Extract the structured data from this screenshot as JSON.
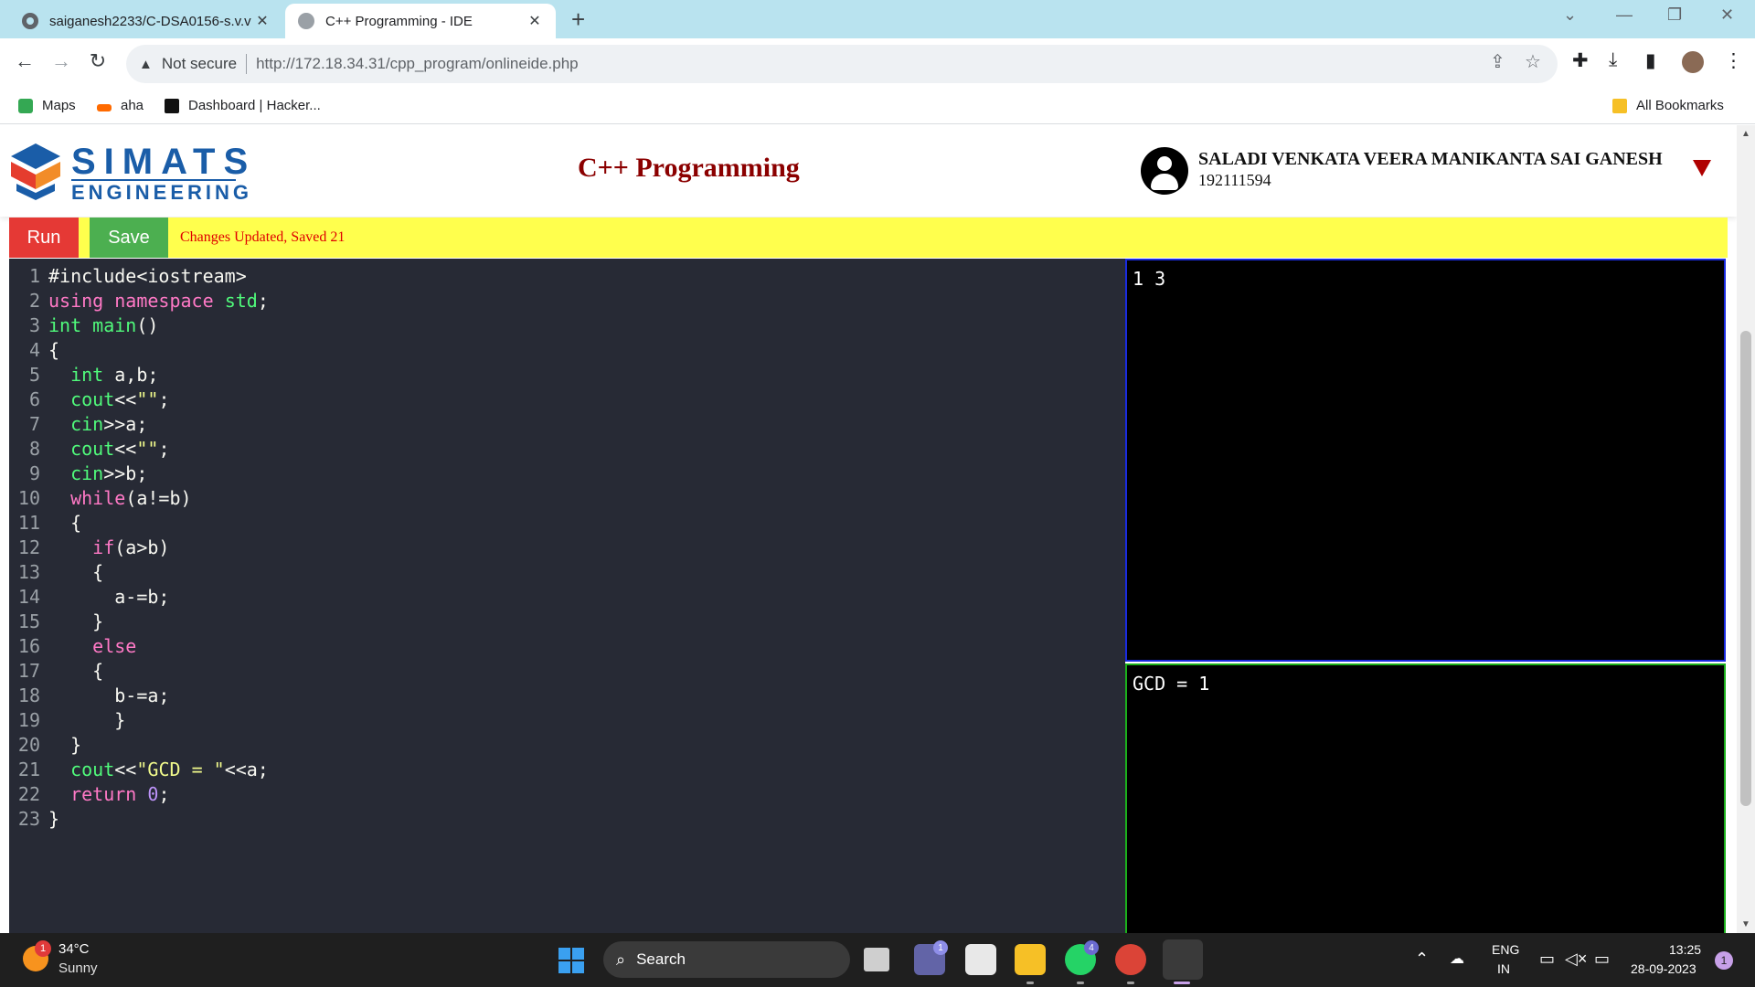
{
  "browser": {
    "tabs": [
      {
        "title": "saiganesh2233/C-DSA0156-s.v.v",
        "active": false
      },
      {
        "title": "C++ Programming - IDE",
        "active": true
      }
    ],
    "omnibox": {
      "security_label": "Not secure",
      "url": "http://172.18.34.31/cpp_program/onlineide.php"
    },
    "bookmarks": [
      {
        "label": "Maps"
      },
      {
        "label": "aha"
      },
      {
        "label": "Dashboard | Hacker..."
      }
    ],
    "all_bookmarks_label": "All Bookmarks"
  },
  "header": {
    "logo_line1": "SIMATS",
    "logo_line2": "ENGINEERING",
    "page_title": "C++ Programming",
    "user_name": "SALADI VENKATA VEERA MANIKANTA SAI GANESH",
    "user_id": "192111594"
  },
  "actions": {
    "run_label": "Run",
    "save_label": "Save",
    "status_message": "Changes Updated, Saved 21"
  },
  "editor": {
    "lines": [
      {
        "n": "1",
        "code": "#include<iostream>"
      },
      {
        "n": "2",
        "code": "using namespace std;"
      },
      {
        "n": "3",
        "code": "int main()"
      },
      {
        "n": "4",
        "code": "{"
      },
      {
        "n": "5",
        "code": "  int a,b;"
      },
      {
        "n": "6",
        "code": "  cout<<\"\";"
      },
      {
        "n": "7",
        "code": "  cin>>a;"
      },
      {
        "n": "8",
        "code": "  cout<<\"\";"
      },
      {
        "n": "9",
        "code": "  cin>>b;"
      },
      {
        "n": "10",
        "code": "  while(a!=b)"
      },
      {
        "n": "11",
        "code": "  {"
      },
      {
        "n": "12",
        "code": "    if(a>b)"
      },
      {
        "n": "13",
        "code": "    {"
      },
      {
        "n": "14",
        "code": "      a-=b;"
      },
      {
        "n": "15",
        "code": "    }"
      },
      {
        "n": "16",
        "code": "    else"
      },
      {
        "n": "17",
        "code": "    {"
      },
      {
        "n": "18",
        "code": "      b-=a;"
      },
      {
        "n": "19",
        "code": "      }"
      },
      {
        "n": "20",
        "code": "  }"
      },
      {
        "n": "21",
        "code": "  cout<<\"GCD = \"<<a;"
      },
      {
        "n": "22",
        "code": "  return 0;"
      },
      {
        "n": "23",
        "code": "}"
      }
    ]
  },
  "input_pane": {
    "text": "1 3"
  },
  "output_pane": {
    "text": "GCD = 1"
  },
  "taskbar": {
    "weather_badge": "1",
    "temperature": "34°C",
    "condition": "Sunny",
    "search_label": "Search",
    "teams_badge": "1",
    "whatsapp_badge": "4",
    "lang_line1": "ENG",
    "lang_line2": "IN",
    "time": "13:25",
    "date": "28-09-2023",
    "notification_count": "1"
  },
  "colors": {
    "page_title": "#8b0000",
    "run_button": "#e53935",
    "save_button": "#4caf50",
    "action_bar": "#ffff4d",
    "status_text": "#e00000",
    "editor_bg": "#272a35",
    "input_border": "#1a2be0",
    "output_border": "#1bb01b"
  }
}
